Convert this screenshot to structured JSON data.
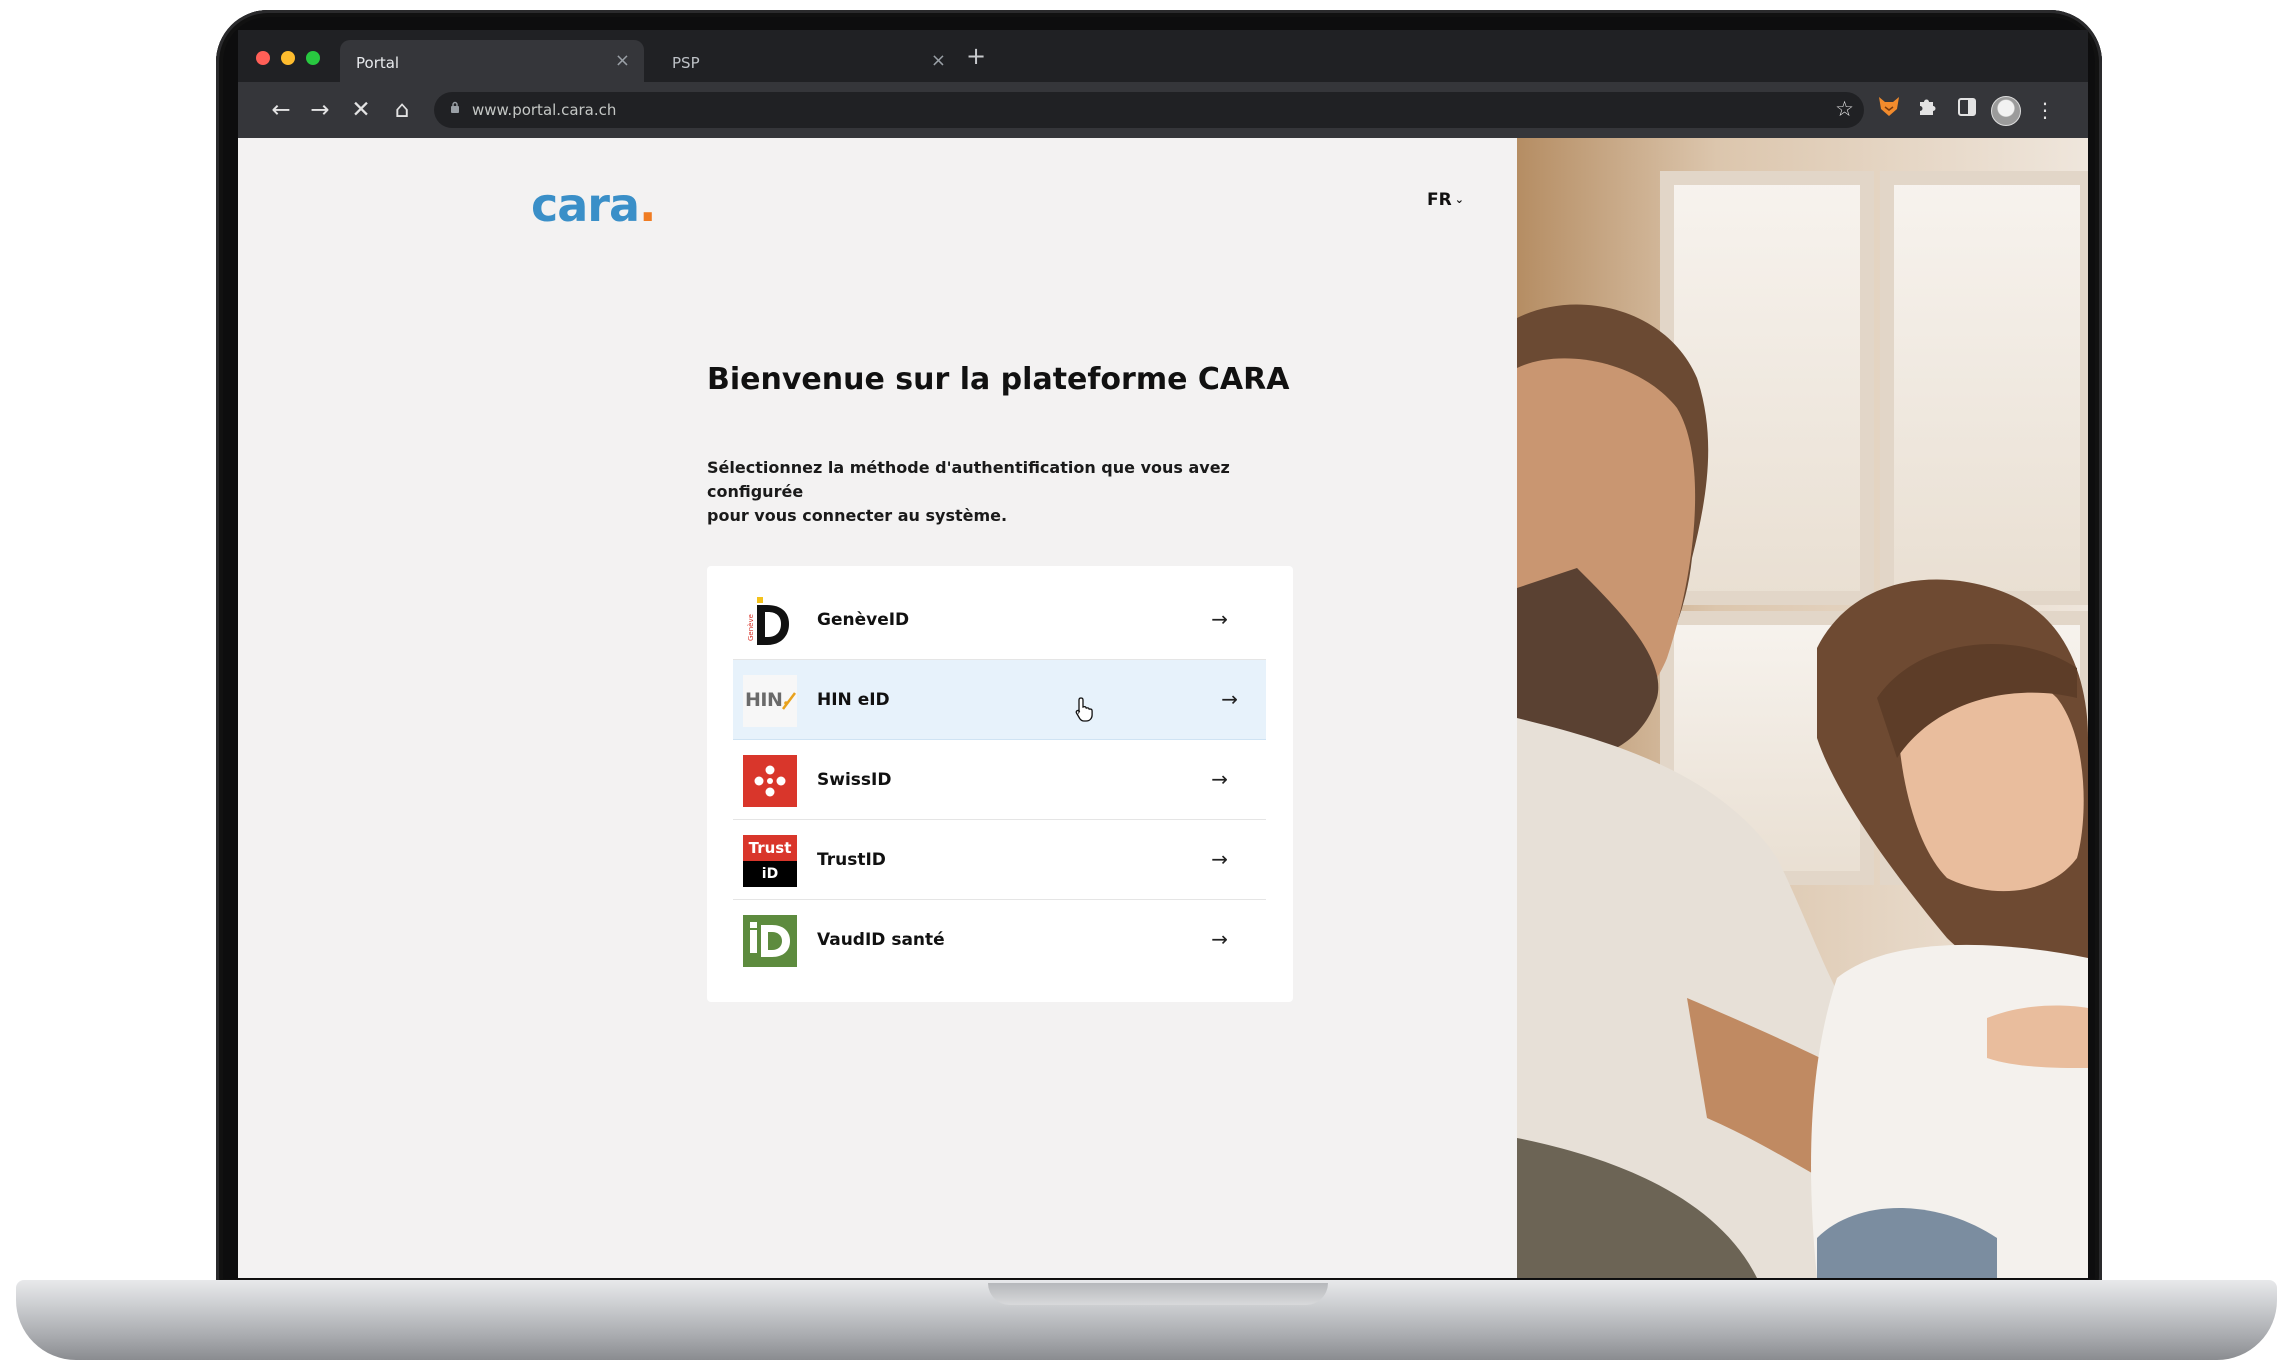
{
  "browser": {
    "tabs": [
      {
        "label": "Portal",
        "active": true
      },
      {
        "label": "PSP",
        "active": false
      }
    ],
    "close_glyph": "×",
    "new_tab_glyph": "+",
    "url": "www.portal.cara.ch",
    "nav": {
      "back": "←",
      "forward": "→",
      "stop": "✕",
      "home": "⌂"
    },
    "bookmark_glyph": "☆",
    "menu_glyph": "⋮"
  },
  "page": {
    "logo_text": "cara",
    "logo_dot": ".",
    "language": "FR",
    "language_chevron": "⌄",
    "title": "Bienvenue sur la plateforme CARA",
    "intro_line1": "Sélectionnez la méthode d'authentification que vous avez configurée",
    "intro_line2": "pour vous connecter au système.",
    "providers": [
      {
        "name": "GenèveID",
        "icon": "geneveid-logo",
        "arrow": "→"
      },
      {
        "name": "HIN eID",
        "icon": "hin-logo",
        "arrow": "→",
        "logo_text": "HIN"
      },
      {
        "name": "SwissID",
        "icon": "swissid-logo",
        "arrow": "→"
      },
      {
        "name": "TrustID",
        "icon": "trustid-logo",
        "arrow": "→",
        "logo_top": "Trust",
        "logo_bottom": "iD"
      },
      {
        "name": "VaudID santé",
        "icon": "vaudid-logo",
        "arrow": "→"
      }
    ]
  },
  "colors": {
    "brand_blue": "#3a8fc8",
    "brand_orange": "#f07c22",
    "hover_row": "#e7f2fb",
    "page_bg": "#f3f2f2"
  }
}
